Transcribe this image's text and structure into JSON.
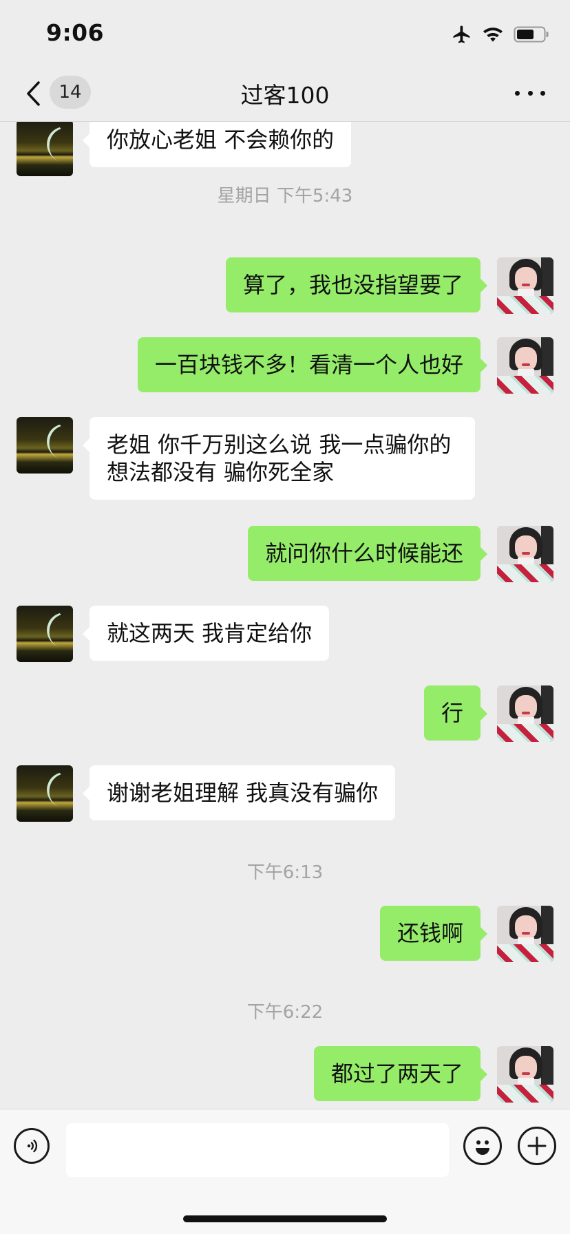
{
  "status_bar": {
    "time": "9:06"
  },
  "nav": {
    "unread_count": "14",
    "title": "过客100"
  },
  "messages": [
    {
      "side": "in",
      "text": "你放心老姐  不会赖你的"
    },
    {
      "type": "timestamp",
      "text": "星期日 下午5:43"
    },
    {
      "side": "out",
      "text": "算了，我也没指望要了"
    },
    {
      "side": "out",
      "text": "一百块钱不多！看清一个人也好"
    },
    {
      "side": "in",
      "text": "老姐 你千万别这么说  我一点骗你的想法都没有  骗你死全家"
    },
    {
      "side": "out",
      "text": "就问你什么时候能还"
    },
    {
      "side": "in",
      "text": "就这两天 我肯定给你"
    },
    {
      "side": "out",
      "text": "行"
    },
    {
      "side": "in",
      "text": "谢谢老姐理解  我真没有骗你"
    },
    {
      "type": "timestamp",
      "text": "下午6:13"
    },
    {
      "side": "out",
      "text": "还钱啊"
    },
    {
      "type": "timestamp",
      "text": "下午6:22"
    },
    {
      "side": "out",
      "text": "都过了两天了"
    }
  ],
  "input": {
    "value": ""
  },
  "colors": {
    "outgoing_bubble": "#95ec69",
    "incoming_bubble": "#ffffff",
    "background": "#ededed"
  },
  "icons": [
    "airplane-icon",
    "wifi-icon",
    "battery-icon",
    "back-chevron-icon",
    "more-icon",
    "voice-icon",
    "emoji-icon",
    "plus-icon"
  ]
}
